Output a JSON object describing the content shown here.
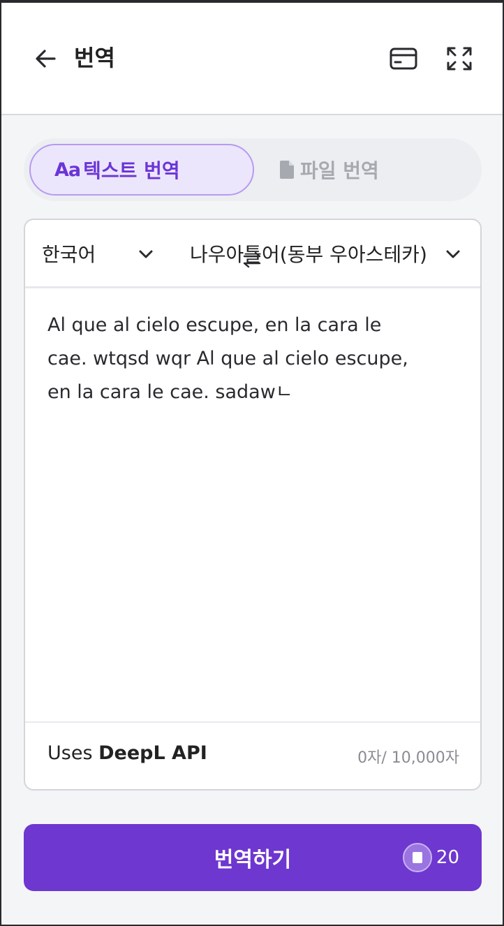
{
  "header": {
    "title": "번역",
    "back_icon": "arrow-left-icon",
    "card_icon": "credit-card-icon",
    "expand_icon": "expand-icon"
  },
  "tabs": {
    "text_tab": {
      "prefix": "Aa",
      "label": "텍스트 번역",
      "active": true
    },
    "file_tab": {
      "icon": "file-icon",
      "label": "파일 번역",
      "active": false
    }
  },
  "languages": {
    "source": "한국어",
    "target": "나우아틀어(동부 우아스테카)"
  },
  "input": {
    "text": "Al que al cielo escupe, en la cara le cae. wtqsd wqr Al que al cielo escupe, en la cara le cae. sadawㄴ"
  },
  "footer": {
    "uses_prefix": "Uses ",
    "provider": "DeepL API",
    "counter": "0자/ 10,000자"
  },
  "action": {
    "label": "번역하기",
    "credit": "20"
  },
  "colors": {
    "accent": "#6e37d0",
    "tab_active_bg": "#ece6fd",
    "tab_active_text": "#6b35d6"
  }
}
